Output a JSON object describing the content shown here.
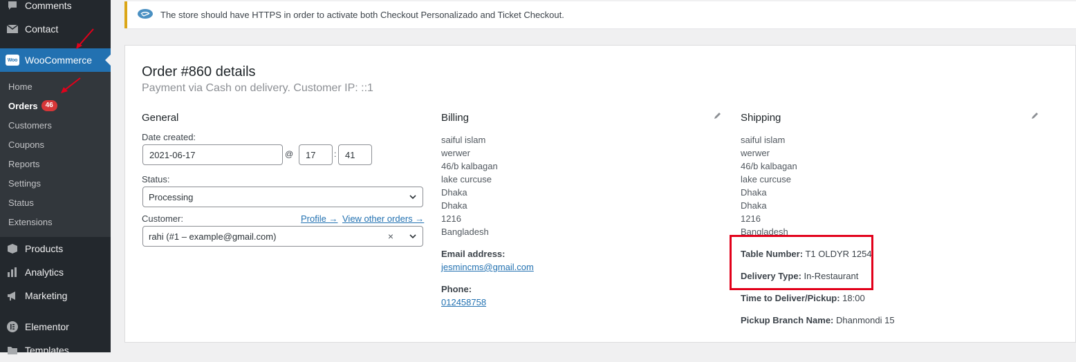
{
  "sidebar": {
    "items": [
      {
        "label": "Comments",
        "icon": "comment-icon"
      },
      {
        "label": "Contact",
        "icon": "mail-icon"
      },
      {
        "label": "WooCommerce",
        "icon": "woocommerce-icon",
        "logo_text": "Woo"
      },
      {
        "label": "Products",
        "icon": "box-icon"
      },
      {
        "label": "Analytics",
        "icon": "bar-chart-icon"
      },
      {
        "label": "Marketing",
        "icon": "megaphone-icon"
      },
      {
        "label": "Elementor",
        "icon": "elementor-icon"
      },
      {
        "label": "Templates",
        "icon": "folder-icon"
      }
    ],
    "submenu": [
      {
        "label": "Home"
      },
      {
        "label": "Orders",
        "badge": "46"
      },
      {
        "label": "Customers"
      },
      {
        "label": "Coupons"
      },
      {
        "label": "Reports"
      },
      {
        "label": "Settings"
      },
      {
        "label": "Status"
      },
      {
        "label": "Extensions"
      }
    ]
  },
  "notice": {
    "text": "The store should have HTTPS in order to activate both Checkout Personalizado and Ticket Checkout.",
    "icon": "payment-logo-icon"
  },
  "order": {
    "title": "Order #860 details",
    "subtitle": "Payment via Cash on delivery. Customer IP: ::1"
  },
  "general": {
    "heading": "General",
    "date_label": "Date created:",
    "date_value": "2021-06-17",
    "at": "@",
    "hour": "17",
    "colon": ":",
    "minute": "41",
    "status_label": "Status:",
    "status_value": "Processing",
    "customer_label": "Customer:",
    "profile_link": "Profile →",
    "other_orders_link": "View other orders →",
    "customer_value": "rahi (#1 – example@gmail.com)",
    "clear": "×"
  },
  "billing": {
    "heading": "Billing",
    "address": [
      "saiful islam",
      "werwer",
      "46/b kalbagan",
      "lake curcuse",
      "Dhaka",
      "Dhaka",
      "1216",
      "Bangladesh"
    ],
    "email_label": "Email address:",
    "email": "jesmincms@gmail.com",
    "phone_label": "Phone:",
    "phone": "012458758"
  },
  "shipping": {
    "heading": "Shipping",
    "address": [
      "saiful islam",
      "werwer",
      "46/b kalbagan",
      "lake curcuse",
      "Dhaka",
      "Dhaka",
      "1216",
      "Bangladesh"
    ],
    "table_label": "Table Number:",
    "table_value": "T1 OLDYR 1254",
    "delivery_label": "Delivery Type:",
    "delivery_value": "In-Restaurant",
    "time_label": "Time to Deliver/Pickup:",
    "time_value": "18:00",
    "branch_label": "Pickup Branch Name:",
    "branch_value": "Dhanmondi 15"
  },
  "colors": {
    "sidebar_bg": "#23282d",
    "submenu_bg": "#32373c",
    "accent": "#2271b1",
    "badge": "#d63638",
    "notice_border": "#dba617",
    "highlight": "#e2001a"
  }
}
